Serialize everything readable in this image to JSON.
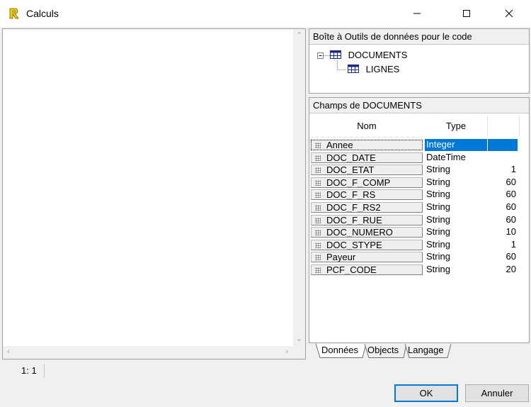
{
  "window": {
    "title": "Calculs",
    "controls": {
      "minimize": "minimize",
      "maximize": "maximize",
      "close": "close"
    }
  },
  "editor": {
    "content": ""
  },
  "toolbox": {
    "header": "Boîte à Outils de données pour le code",
    "tree": [
      {
        "label": "DOCUMENTS",
        "icon": "table-icon",
        "expanded": true
      },
      {
        "label": "LIGNES",
        "icon": "table-icon"
      }
    ]
  },
  "fields": {
    "header": "Champs de DOCUMENTS",
    "columns": {
      "name": "Nom",
      "type": "Type"
    },
    "rows": [
      {
        "name": "Annee",
        "type": "Integer",
        "length": "",
        "selected": true
      },
      {
        "name": "DOC_DATE",
        "type": "DateTime",
        "length": ""
      },
      {
        "name": "DOC_ETAT",
        "type": "String",
        "length": "1"
      },
      {
        "name": "DOC_F_COMP",
        "type": "String",
        "length": "60"
      },
      {
        "name": "DOC_F_RS",
        "type": "String",
        "length": "60"
      },
      {
        "name": "DOC_F_RS2",
        "type": "String",
        "length": "60"
      },
      {
        "name": "DOC_F_RUE",
        "type": "String",
        "length": "60"
      },
      {
        "name": "DOC_NUMERO",
        "type": "String",
        "length": "10"
      },
      {
        "name": "DOC_STYPE",
        "type": "String",
        "length": "1"
      },
      {
        "name": "Payeur",
        "type": "String",
        "length": "60"
      },
      {
        "name": "PCF_CODE",
        "type": "String",
        "length": "20"
      }
    ]
  },
  "tabs": [
    "Données",
    "Objects",
    "Langage"
  ],
  "status": {
    "position": "1: 1"
  },
  "buttons": {
    "ok": "OK",
    "cancel": "Annuler"
  },
  "colors": {
    "selection": "#0078d7",
    "app_icon": "#ffd700"
  }
}
